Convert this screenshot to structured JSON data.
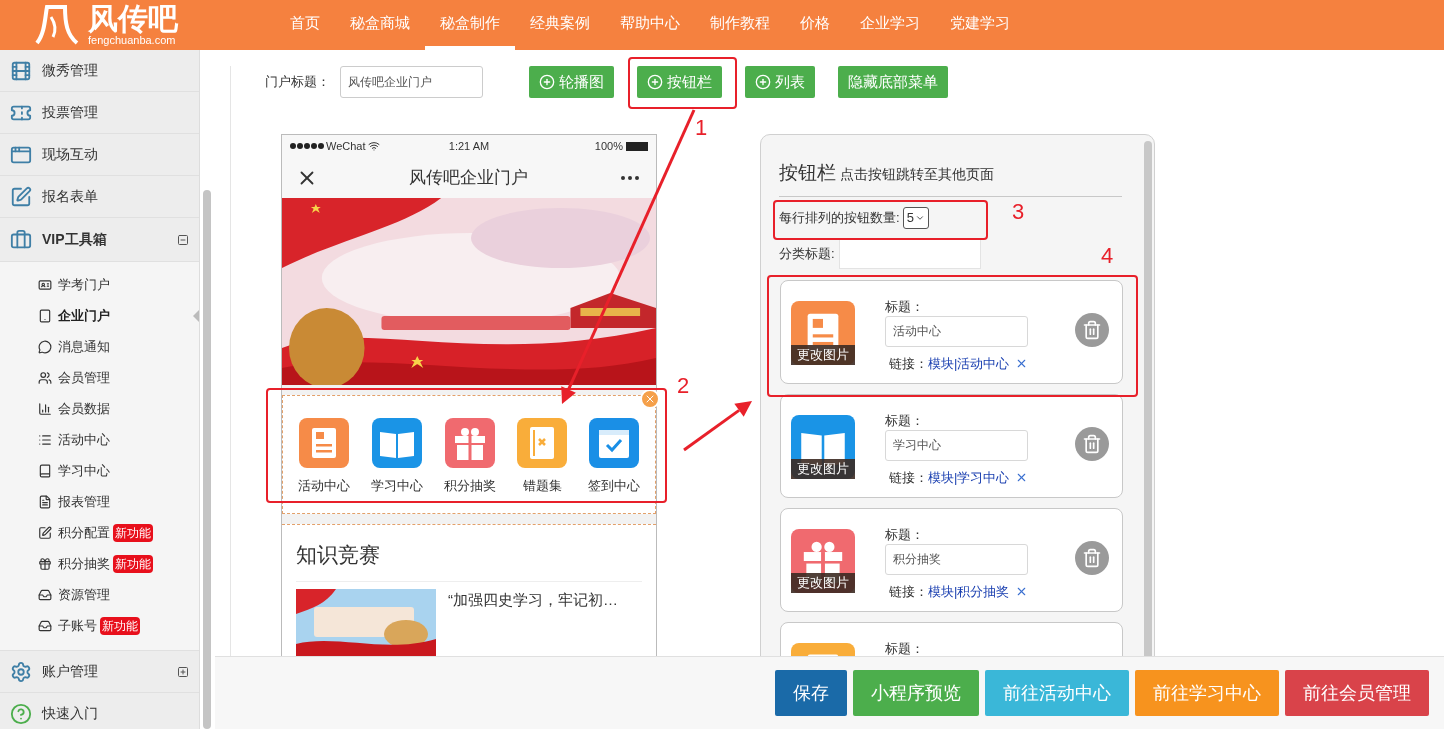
{
  "header": {
    "logo": {
      "name": "风传吧",
      "domain": "fengchuanba.com"
    },
    "nav": [
      {
        "label": "首页",
        "selected": false
      },
      {
        "label": "秘盒商城",
        "selected": false
      },
      {
        "label": "秘盒制作",
        "selected": true
      },
      {
        "label": "经典案例",
        "selected": false
      },
      {
        "label": "帮助中心",
        "selected": false
      },
      {
        "label": "制作教程",
        "selected": false
      },
      {
        "label": "价格",
        "selected": false
      },
      {
        "label": "企业学习",
        "selected": false
      },
      {
        "label": "党建学习",
        "selected": false
      }
    ]
  },
  "sidebar": {
    "items": [
      {
        "label": "微秀管理"
      },
      {
        "label": "投票管理"
      },
      {
        "label": "现场互动"
      },
      {
        "label": "报名表单"
      },
      {
        "label": "VIP工具箱",
        "expanded": true,
        "children": [
          {
            "label": "学考门户",
            "selected": false
          },
          {
            "label": "企业门户",
            "selected": true
          },
          {
            "label": "消息通知",
            "selected": false
          },
          {
            "label": "会员管理",
            "selected": false
          },
          {
            "label": "会员数据",
            "selected": false
          },
          {
            "label": "活动中心",
            "selected": false
          },
          {
            "label": "学习中心",
            "selected": false
          },
          {
            "label": "报表管理",
            "selected": false
          },
          {
            "label": "积分配置",
            "selected": false,
            "badge": "新功能"
          },
          {
            "label": "积分抽奖",
            "selected": false,
            "badge": "新功能"
          },
          {
            "label": "资源管理",
            "selected": false
          },
          {
            "label": "子账号",
            "selected": false,
            "badge": "新功能"
          }
        ]
      },
      {
        "label": "账户管理",
        "expanded": false
      },
      {
        "label": "快速入门"
      }
    ]
  },
  "portal_title": {
    "label": "门户标题：",
    "value": "风传吧企业门户"
  },
  "toolbar": [
    {
      "label": "轮播图",
      "kind": "add"
    },
    {
      "label": "按钮栏",
      "kind": "add"
    },
    {
      "label": "列表",
      "kind": "add"
    },
    {
      "label": "隐藏底部菜单",
      "kind": "plain"
    }
  ],
  "phone": {
    "status_bar": {
      "carrier": "WeChat",
      "time": "1:21 AM",
      "battery": "100%"
    },
    "title": "风传吧企业门户",
    "button_bar": [
      {
        "label": "活动中心",
        "color": "#f68b48"
      },
      {
        "label": "学习中心",
        "color": "#1a94e6"
      },
      {
        "label": "积分抽奖",
        "color": "#f06a6f"
      },
      {
        "label": "错题集",
        "color": "#f9ad3a"
      },
      {
        "label": "签到中心",
        "color": "#1a8fe6"
      }
    ],
    "section": {
      "title": "知识竞赛",
      "articles": [
        {
          "title": "“加强四史学习，牢记初…"
        }
      ]
    }
  },
  "editor": {
    "title": "按钮栏",
    "subtitle": "点击按钮跳转至其他页面",
    "per_row": {
      "label": "每行排列的按钮数量:",
      "value": "5"
    },
    "category": {
      "label": "分类标题:"
    },
    "buttons": [
      {
        "color": "#f68b48",
        "change_image": "更改图片",
        "title_label": "标题：",
        "title_value": "活动中心",
        "link_label": "链接：",
        "link": "模块|活动中心"
      },
      {
        "color": "#1a94e6",
        "change_image": "更改图片",
        "title_label": "标题：",
        "title_value": "学习中心",
        "link_label": "链接：",
        "link": "模块|学习中心"
      },
      {
        "color": "#f06a6f",
        "change_image": "更改图片",
        "title_label": "标题：",
        "title_value": "积分抽奖",
        "link_label": "链接：",
        "link": "模块|积分抽奖"
      },
      {
        "color": "#f9ad3a",
        "title_label": "标题："
      }
    ]
  },
  "annotations": [
    {
      "label": "1"
    },
    {
      "label": "2"
    },
    {
      "label": "3"
    },
    {
      "label": "4"
    }
  ],
  "actions": [
    {
      "label": "保存",
      "color": "#1a6aa8"
    },
    {
      "label": "小程序预览",
      "color": "#4cae4c"
    },
    {
      "label": "前往活动中心",
      "color": "#3ab7d8"
    },
    {
      "label": "前往学习中心",
      "color": "#f7931e"
    },
    {
      "label": "前往会员管理",
      "color": "#d9434a"
    }
  ]
}
